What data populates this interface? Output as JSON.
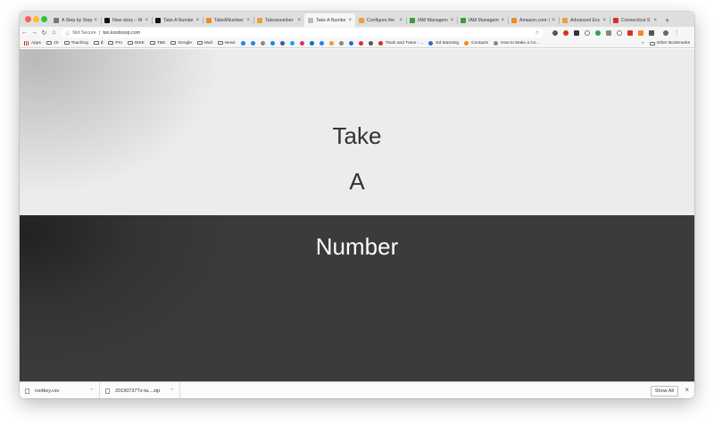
{
  "browser": {
    "traffic_lights": [
      "#fe5f57",
      "#febc2e",
      "#28c840"
    ],
    "tabs": [
      {
        "title": "A Step by Step",
        "favicon": "pin-icon",
        "color": "#777777",
        "active": false
      },
      {
        "title": "New story – M",
        "favicon": "medium-icon",
        "color": "#111111",
        "active": false
      },
      {
        "title": "Take A Numbe",
        "favicon": "medium-icon",
        "color": "#111111",
        "active": false
      },
      {
        "title": "TakeANumber",
        "favicon": "app-icon",
        "color": "#f08a24",
        "active": false
      },
      {
        "title": "Takeanumber",
        "favicon": "folder-icon",
        "color": "#e9a23b",
        "active": false
      },
      {
        "title": "Take A Numbe",
        "favicon": "page-icon",
        "color": "#bbbbbb",
        "active": true
      },
      {
        "title": "Configure the",
        "favicon": "aws-icon",
        "color": "#e9a23b",
        "active": false
      },
      {
        "title": "IAM Managem",
        "favicon": "key-icon",
        "color": "#3d9a3d",
        "active": false
      },
      {
        "title": "IAM Managem",
        "favicon": "key-icon",
        "color": "#3d9a3d",
        "active": false
      },
      {
        "title": "Amazon.com: I",
        "favicon": "amazon-icon",
        "color": "#f08a24",
        "active": false
      },
      {
        "title": "Advanced Exc",
        "favicon": "aws-icon",
        "color": "#e9a23b",
        "active": false
      },
      {
        "title": "Connecticut S",
        "favicon": "gmail-icon",
        "color": "#d93025",
        "active": false
      }
    ],
    "address": {
      "security": "Not Secure",
      "url": "tan.kootsoop.com"
    },
    "bookmarks": [
      {
        "label": "Apps",
        "type": "apps"
      },
      {
        "label": "JS",
        "type": "folder"
      },
      {
        "label": "Teaching",
        "type": "folder"
      },
      {
        "label": "$",
        "type": "folder"
      },
      {
        "label": "Pro",
        "type": "folder"
      },
      {
        "label": "IEEE",
        "type": "folder"
      },
      {
        "label": "TBD",
        "type": "folder"
      },
      {
        "label": "Google",
        "type": "folder"
      },
      {
        "label": "Mail",
        "type": "folder"
      },
      {
        "label": "News",
        "type": "folder"
      }
    ],
    "bookmark_icons": [
      "#1e88e5",
      "#1e88e5",
      "#888888",
      "#1e88e5",
      "#3b5998",
      "#1da1f2",
      "#e1306c",
      "#0077b5",
      "#1e88e5",
      "#f0a020",
      "#888888",
      "#3367d6",
      "#d93025",
      "#555555"
    ],
    "bookmarks_right": [
      {
        "label": "Track and Trace - ...",
        "color": "#d93025"
      },
      {
        "label": "Ed Manning",
        "color": "#3367d6"
      },
      {
        "label": "Contacts",
        "color": "#f08a24"
      },
      {
        "label": "How to Make a Co...",
        "color": "#888888"
      }
    ],
    "other_bookmarks": "Other Bookmarks",
    "more_chevron": "»"
  },
  "page": {
    "word1": "Take",
    "word2": "A",
    "word3": "Number"
  },
  "downloads": {
    "items": [
      {
        "name": "rootkey.csv"
      },
      {
        "name": "20190737Tz-ta....zip"
      }
    ],
    "show_all": "Show All",
    "close": "×"
  }
}
